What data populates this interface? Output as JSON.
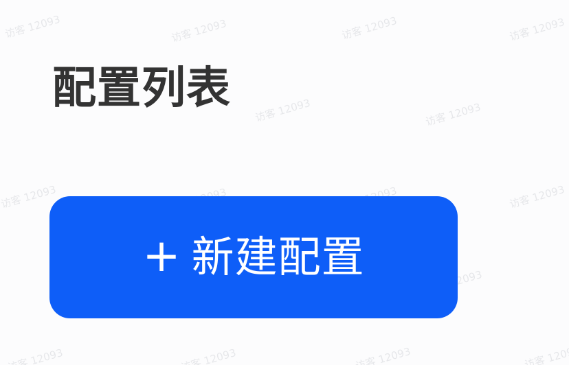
{
  "page": {
    "title": "配置列表"
  },
  "toolbar": {
    "new_config_icon": "plus-icon",
    "new_config_plus": "+",
    "new_config_label": "新建配置"
  },
  "watermark": {
    "text": "访客 12093"
  },
  "colors": {
    "background": "#fcfcfd",
    "title_text": "#333333",
    "primary_button": "#0e5ef8",
    "button_text": "#ffffff"
  }
}
